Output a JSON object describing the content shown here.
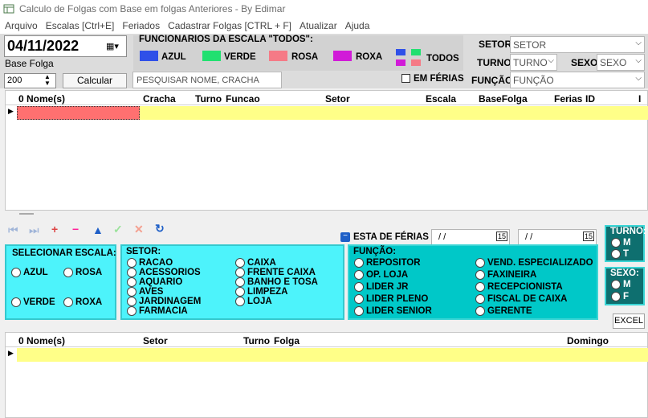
{
  "window": {
    "title": "Calculo de Folgas com Base em folgas Anteriores - By Edimar"
  },
  "menu": [
    "Arquivo",
    "Escalas [Ctrl+E]",
    "Feriados",
    "Cadastrar Folgas [CTRL + F]",
    "Atualizar",
    "Ajuda"
  ],
  "top": {
    "date": "04/11/2022",
    "date_label": "Base Folga",
    "spin_value": "200",
    "calc_button": "Calcular Folgas",
    "search_placeholder": "PESQUISAR NOME, CRACHA",
    "ferias_label": "EM FÉRIAS",
    "func_title": "FUNCIONARIOS DA ESCALA  \"TODOS\":",
    "scales": [
      {
        "label": "AZUL",
        "color": "#2f50e8"
      },
      {
        "label": "VERDE",
        "color": "#21e070"
      },
      {
        "label": "ROSA",
        "color": "#f57a86"
      },
      {
        "label": "ROXA",
        "color": "#d11bd8"
      },
      {
        "label": "TODOS"
      }
    ],
    "setor_label": "SETOR",
    "setor_value": "SETOR",
    "turno_label": "TURNO",
    "turno_value": "TURNO",
    "sexo_label": "SEXO",
    "sexo_value": "SEXO",
    "funcao_label": "FUNÇÃO",
    "funcao_value": "FUNÇÃO"
  },
  "grid1": {
    "columns": [
      "0 Nome(s)",
      "Cracha",
      "Turno",
      "Funcao",
      "Setor",
      "Escala",
      "BaseFolga",
      "Ferias",
      "ID",
      "I"
    ]
  },
  "ferias": {
    "label": "ESTA DE FÉRIAS",
    "date1": "/ /",
    "date2": "/ /"
  },
  "escala_panel": {
    "title": "SELECIONAR ESCALA:",
    "options": [
      "AZUL",
      "ROSA",
      "VERDE",
      "ROXA"
    ]
  },
  "setor_panel": {
    "title": "SETOR:",
    "col1": [
      "RACAO",
      "ACESSORIOS",
      "AQUARIO",
      "AVES",
      "JARDINAGEM",
      "FARMACIA"
    ],
    "col2": [
      "CAIXA",
      "FRENTE CAIXA",
      "BANHO E TOSA",
      "LIMPEZA",
      "LOJA"
    ]
  },
  "funcao_panel": {
    "title": "FUNÇÃO:",
    "col1": [
      "REPOSITOR",
      "OP. LOJA",
      "LIDER JR",
      "LIDER PLENO",
      "LIDER SENIOR"
    ],
    "col2": [
      "VEND. ESPECIALIZADO",
      "FAXINEIRA",
      "RECEPCIONISTA",
      "FISCAL DE CAIXA",
      "GERENTE"
    ]
  },
  "turno_panel": {
    "title": "TURNO:",
    "options": [
      "M",
      "T"
    ]
  },
  "sexo_panel": {
    "title": "SEXO:",
    "options": [
      "M",
      "F"
    ]
  },
  "excel_button": "EXCEL",
  "grid2": {
    "columns": [
      "0 Nome(s)",
      "Setor",
      "Turno",
      "Folga",
      "Domingo"
    ]
  }
}
